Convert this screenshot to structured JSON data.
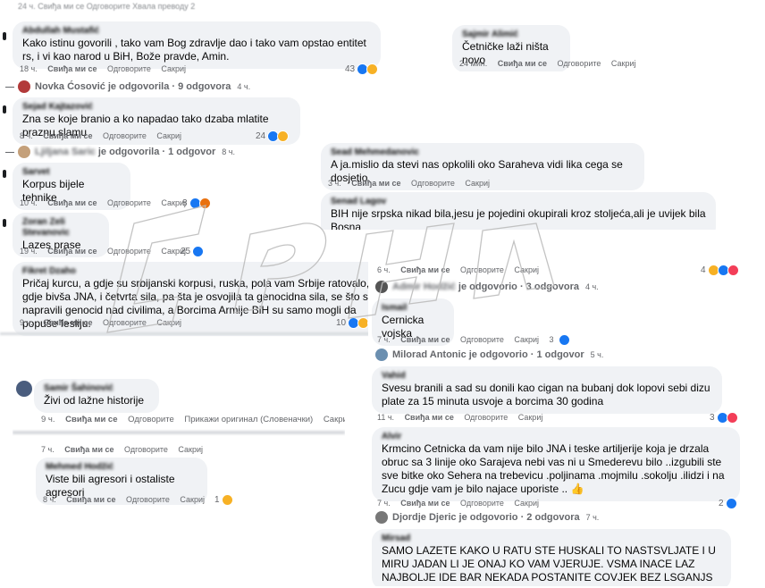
{
  "left": {
    "top_cut": {
      "text": "24 ч.   Свиђа ми се   Одговорите   Хвала преводу   2",
      "reacts": [
        "like",
        "haha"
      ]
    },
    "c1": {
      "author": "Abdullah Mustafić",
      "text": "Kako istinu govorili , tako vam Bog zdravlje dao i tako vam opstao entitet rs, i vi kao narod u BiH, Bože pravde, Amin.",
      "time": "18 ч.",
      "like": "Свиђа ми се",
      "reply": "Одговорите",
      "hide": "Сакриј",
      "count": "43"
    },
    "r1": {
      "name": "Novka Ćosović",
      "text": "je odgovorila · 9 odgovora",
      "time": "4 ч."
    },
    "c2": {
      "author": "Sejad Kajtazović",
      "text": "Zna se koje branio a ko napadao tako dzaba mlatite praznu slamu",
      "time": "8 ч.",
      "like": "Свиђа ми се",
      "reply": "Одговорите",
      "hide": "Сакриј",
      "count": "24"
    },
    "r2": {
      "name": "Ljiljana Saric",
      "text": "je odgovorila · 1 odgovor",
      "time": "8 ч."
    },
    "c3": {
      "author": "Sarvet",
      "text": "Korpus bijele tehnike",
      "time": "10 ч.",
      "like": "Свиђа ми се",
      "reply": "Одговорите",
      "hide": "Сакриј",
      "count": "8"
    },
    "c4": {
      "author": "Zoran Zeli Stevanovic",
      "text": "Lazes prase",
      "time": "19 ч.",
      "like": "Свиђа ми се",
      "reply": "Одговорите",
      "hide": "Сакриј",
      "count": "25"
    },
    "c5": {
      "author": "Fikret Dzaho",
      "text": "Pričaj kurcu, a gdje su srbijanski korpusi, ruska, pola vam Srbije ratovalo, gdje bivša JNA, i četvrta sila, pa šta je osvojila ta genocidna sila, se što su napravili genocid nad civilima, a Borcima Armije BiH su samo mogli da popuše fesliju.",
      "time": "9 ч.",
      "like": "Свиђа ми се",
      "reply": "Одговорите",
      "hide": "Сакриј",
      "count": "10"
    }
  },
  "bottom_left": {
    "c1": {
      "author": "Samir Šahinović",
      "text": "Živi od lažne historije",
      "time": "9 ч.",
      "like": "Свиђа ми се",
      "reply": "Одговорите",
      "translate": "Прикажи оригинал (Словеначки)",
      "hide": "Сакриј"
    },
    "c2_actions": {
      "time": "7 ч.",
      "like": "Свиђа ми се",
      "reply": "Одговорите",
      "hide": "Сакриј"
    },
    "c3": {
      "author": "Mehmed Hodžić",
      "text": "Viste bili agresori i ostaliste agresori",
      "time": "8 ч.",
      "like": "Свиђа ми се",
      "reply": "Одговорите",
      "hide": "Сакриј",
      "count": "1"
    }
  },
  "top_right": {
    "c1": {
      "author": "Sajmir Alimić",
      "text": "Četničke laži ništa novo",
      "time": "24 мин.",
      "like": "Свиђа ми се",
      "reply": "Одговорите",
      "hide": "Сакриј"
    }
  },
  "mid_right": {
    "c1": {
      "author": "Sead Mehmedanovic",
      "text": "A ja.mislio da stevi nas opkolili oko Saraheva vidi lika cega se dosjetio",
      "time": "3 ч.",
      "like": "Свиђа ми се",
      "reply": "Одговорите",
      "hide": "Сакриј"
    },
    "c2": {
      "author": "Senad Lagov",
      "text": "BIH nije srpska nikad bila,jesu je pojedini okupirali kroz stoljeća,ali je uvijek bila Bosna"
    }
  },
  "right": {
    "top_actions": {
      "time": "6 ч.",
      "like": "Свиђа ми се",
      "reply": "Одговорите",
      "hide": "Сакриј",
      "count": "4"
    },
    "r1": {
      "name": "Admir Hodžić",
      "text": "je odgovorio · 3 odgovora",
      "time": "4 ч."
    },
    "c1": {
      "author": "Ismail",
      "text": "Cernicka vojska",
      "time": "7 ч.",
      "like": "Свиђа ми се",
      "reply": "Одговорите",
      "hide": "Сакриј",
      "count": "3"
    },
    "r2": {
      "name": "Milorad Antonic",
      "text": "je odgovorio · 1 odgovor",
      "time": "5 ч."
    },
    "c2": {
      "author": "Vahid",
      "text": "Svesu branili a sad su donili kao cigan na bubanj dok lopovi sebi dizu plate za 15 minuta usvoje a borcima 30 godina",
      "time": "11 ч.",
      "like": "Свиђа ми се",
      "reply": "Одговорите",
      "hide": "Сакриј",
      "count": "3"
    },
    "c3": {
      "author": "Alvir",
      "text": "Krmcino Cetnicka da vam nije bilo JNA i teske artiljerije koja je drzala obruc sa 3 linije oko Sarajeva nebi vas ni u Smederevu bilo ..izgubili ste sve bitke oko Sehera na trebevicu .poljinama .mojmilu .sokolju .ilidzi i na Zucu gdje vam je bilo najace uporiste .. 👍",
      "time": "7 ч.",
      "like": "Свиђа ми се",
      "reply": "Одговорите",
      "hide": "Сакриј",
      "count": "2"
    },
    "r3": {
      "name": "Djordje Djeric",
      "text": "je odgovorio · 2 odgovora",
      "time": "7 ч."
    },
    "c4": {
      "author": "Mirsad",
      "text": "SAMO LAZETE KAKO U RATU STE HUSKALI TO NASTSVLJATE I U MIRU JADAN LI JE ONAJ KO VAM VJERUJE. VSMA INACE LAZ NAJBOLJE IDE BAR NEKADA POSTANITE COVJEK BEZ LSGANJS"
    }
  },
  "watermark": {
    "text": "СРПСКА",
    "color": "#cccccc"
  },
  "colors": {
    "bubble": "#f0f2f5",
    "meta": "#65676b",
    "like_blue": "#1877f2"
  }
}
